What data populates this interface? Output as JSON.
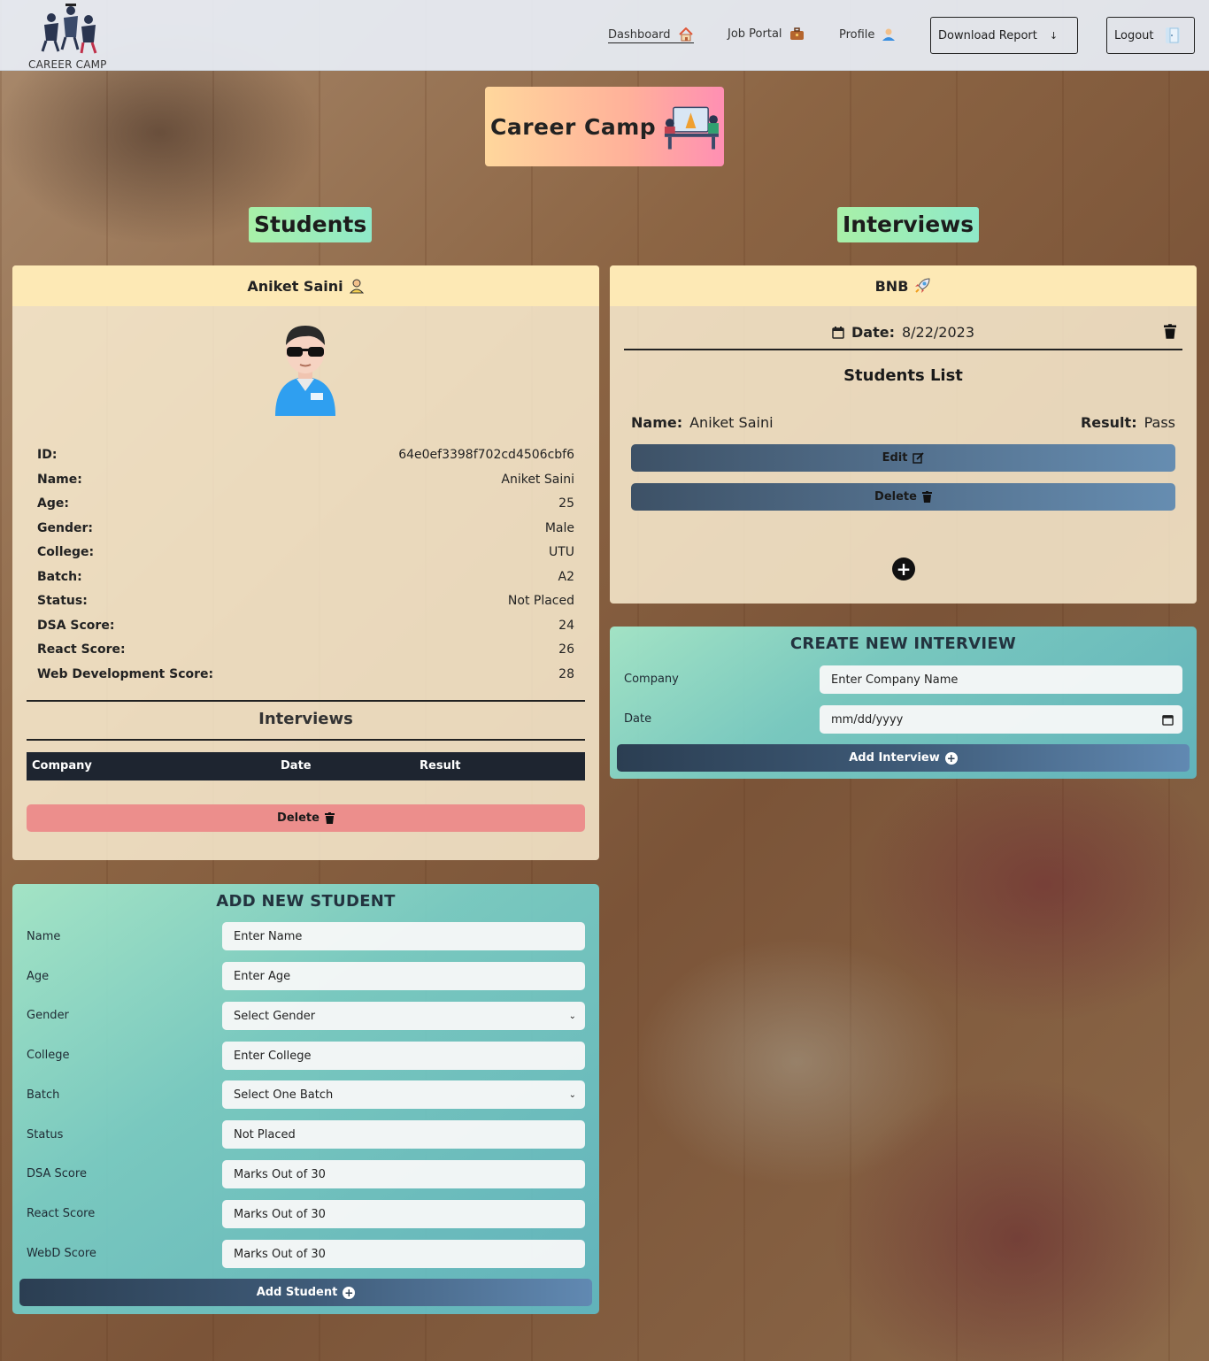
{
  "nav": {
    "brand": "CAREER CAMP",
    "links": [
      {
        "label": "Dashboard",
        "icon": "home-icon"
      },
      {
        "label": "Job Portal",
        "icon": "briefcase-icon"
      },
      {
        "label": "Profile",
        "icon": "user-icon"
      }
    ],
    "download_label": "Download Report",
    "logout_label": "Logout"
  },
  "hero": {
    "title": "Career Camp"
  },
  "sections": {
    "students": "Students",
    "interviews": "Interviews"
  },
  "student_card": {
    "name": "Aniket Saini",
    "fields": [
      {
        "key": "ID:",
        "value": "64e0ef3398f702cd4506cbf6"
      },
      {
        "key": "Name:",
        "value": "Aniket Saini"
      },
      {
        "key": "Age:",
        "value": "25"
      },
      {
        "key": "Gender:",
        "value": "Male"
      },
      {
        "key": "College:",
        "value": "UTU"
      },
      {
        "key": "Batch:",
        "value": "A2"
      },
      {
        "key": "Status:",
        "value": "Not Placed"
      },
      {
        "key": "DSA Score:",
        "value": "24"
      },
      {
        "key": "React Score:",
        "value": "26"
      },
      {
        "key": "Web Development Score:",
        "value": "28"
      }
    ],
    "interviews_heading": "Interviews",
    "table_headers": [
      "Company",
      "Date",
      "Result"
    ],
    "delete_label": "Delete"
  },
  "interview_card": {
    "company": "BNB",
    "date_label": "Date:",
    "date_value": "8/22/2023",
    "students_list_heading": "Students List",
    "student_name_label": "Name:",
    "student_name": "Aniket Saini",
    "result_label": "Result:",
    "result_value": "Pass",
    "edit_label": "Edit",
    "delete_label": "Delete"
  },
  "create_interview": {
    "title": "CREATE NEW INTERVIEW",
    "company_label": "Company",
    "company_placeholder": "Enter Company Name",
    "date_label": "Date",
    "date_placeholder": "mm/dd/yyyy",
    "submit_label": "Add Interview"
  },
  "add_student": {
    "title": "ADD NEW STUDENT",
    "fields": [
      {
        "label": "Name",
        "placeholder": "Enter Name",
        "type": "text"
      },
      {
        "label": "Age",
        "placeholder": "Enter Age",
        "type": "text"
      },
      {
        "label": "Gender",
        "placeholder": "Select Gender",
        "type": "select"
      },
      {
        "label": "College",
        "placeholder": "Enter College",
        "type": "text"
      },
      {
        "label": "Batch",
        "placeholder": "Select One Batch",
        "type": "select"
      },
      {
        "label": "Status",
        "placeholder": "Not Placed",
        "type": "text"
      },
      {
        "label": "DSA Score",
        "placeholder": "Marks Out of 30",
        "type": "text"
      },
      {
        "label": "React Score",
        "placeholder": "Marks Out of 30",
        "type": "text"
      },
      {
        "label": "WebD Score",
        "placeholder": "Marks Out of 30",
        "type": "text"
      }
    ],
    "submit_label": "Add Student"
  },
  "colors": {
    "card_header": "#fde9b5",
    "delete_red": "#ec8e8c",
    "dark_button": "#2b3e52",
    "section_title": "#a8f0a8"
  }
}
